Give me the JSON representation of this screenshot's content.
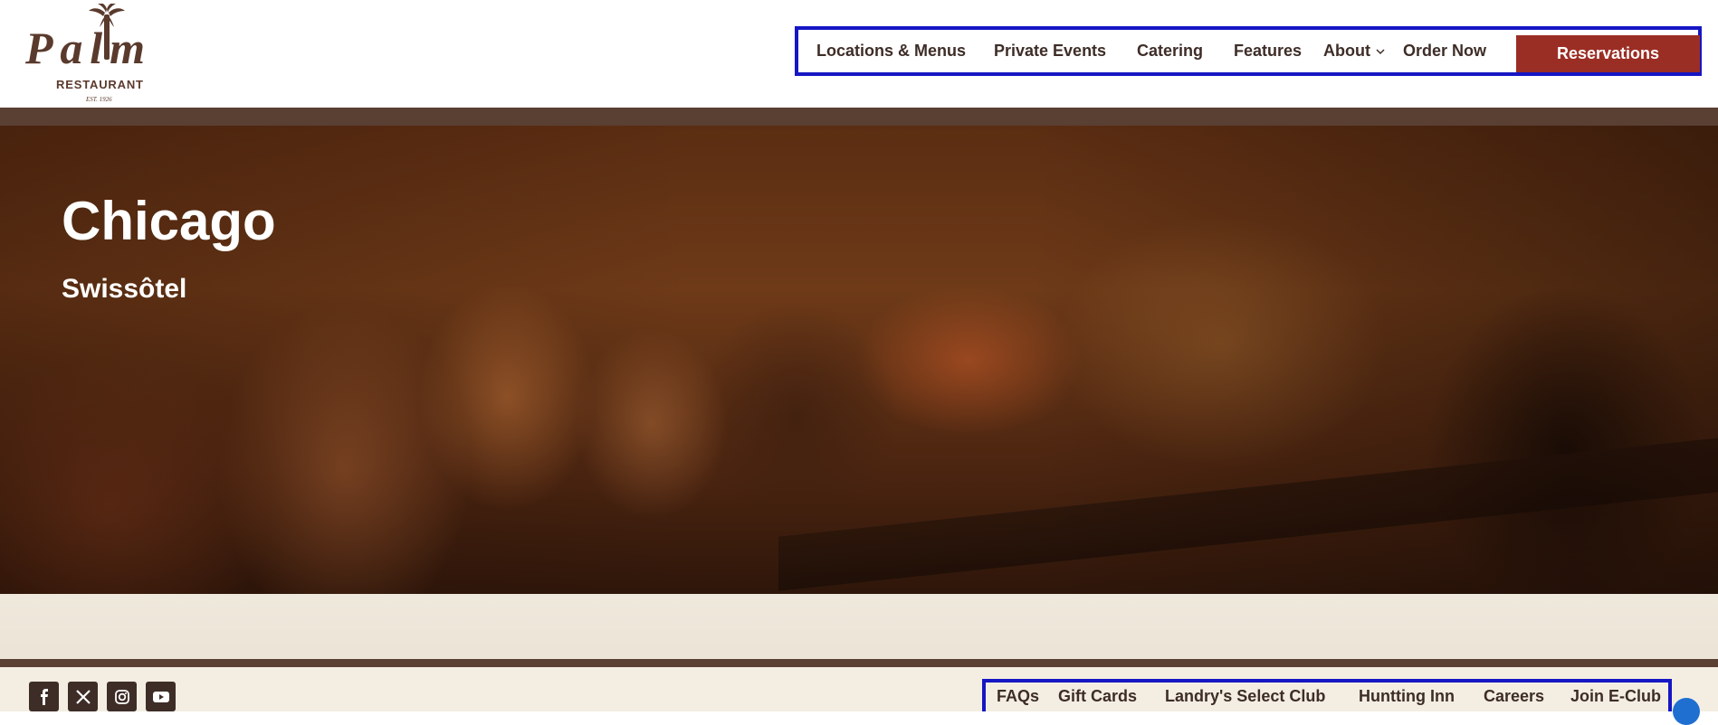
{
  "logo": {
    "brand": "Palm",
    "subtitle": "RESTAURANT",
    "established": "EST. 1926"
  },
  "nav": {
    "items": [
      {
        "label": "Locations & Menus"
      },
      {
        "label": "Private Events"
      },
      {
        "label": "Catering"
      },
      {
        "label": "Features"
      },
      {
        "label": "About",
        "has_dropdown": true
      },
      {
        "label": "Order Now"
      }
    ],
    "reservations_label": "Reservations"
  },
  "hero": {
    "city": "Chicago",
    "venue": "Swissôtel"
  },
  "footer": {
    "social": [
      {
        "icon": "facebook-icon"
      },
      {
        "icon": "x-icon"
      },
      {
        "icon": "instagram-icon"
      },
      {
        "icon": "youtube-icon"
      }
    ],
    "links": [
      {
        "label": "FAQs"
      },
      {
        "label": "Gift Cards"
      },
      {
        "label": "Landry's Select Club"
      },
      {
        "label": "Huntting Inn"
      },
      {
        "label": "Careers"
      },
      {
        "label": "Join E-Club"
      }
    ]
  },
  "colors": {
    "brand_brown": "#3e2d27",
    "accent_red": "#9b2e24",
    "band": "#5a3f33",
    "highlight_border": "#1616c4"
  }
}
